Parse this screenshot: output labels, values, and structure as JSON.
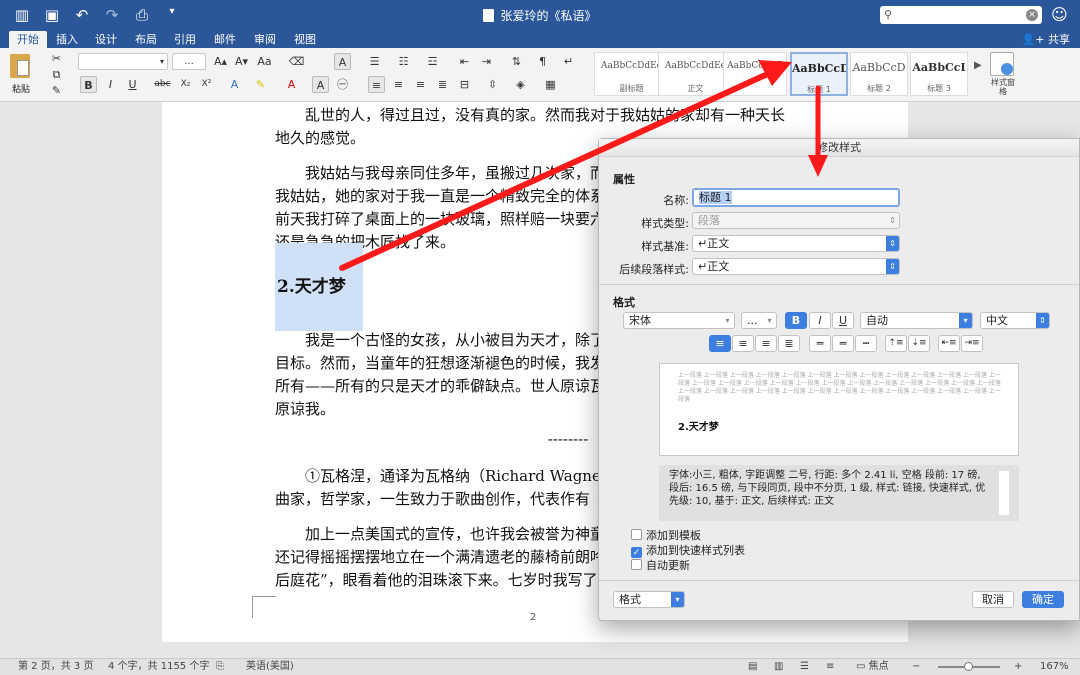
{
  "titlebar": {
    "doc_title": "张爱玲的《私语》",
    "search_placeholder": "",
    "icons": [
      "sidebar-icon",
      "save-icon",
      "undo-icon",
      "redo-icon",
      "print-icon",
      "customize-icon"
    ]
  },
  "tabs": [
    "开始",
    "插入",
    "设计",
    "布局",
    "引用",
    "邮件",
    "审阅",
    "视图"
  ],
  "share_label": "共享",
  "ribbon": {
    "paste_label": "粘贴",
    "font_name": "",
    "font_size": "...",
    "styles": [
      {
        "sample": "AaBbCcDdEe",
        "name": "副标题"
      },
      {
        "sample": "AaBbCcDdEe",
        "name": "正文"
      },
      {
        "sample": "AaBbCcDdE",
        "name": ""
      },
      {
        "sample": "AaBbCcD",
        "name": "标题 1"
      },
      {
        "sample": "AaBbCcD",
        "name": "标题 2"
      },
      {
        "sample": "AaBbCcI",
        "name": "标题 3"
      }
    ],
    "style_pane_label": "样式窗格"
  },
  "document": {
    "para1": "乱世的人，得过且过，没有真的家。然而我对于我姑姑的家却有一种天长地久的感觉。",
    "para2": "我姑姑与我母亲同住多年，虽搬过几次家，而我母亲不在的时候，单剩下我姑姑，她的家对于我一直是一个精致完全的体系，无论如何不能稍有毁损。前天我打碎了桌面上的一块玻璃，照样赔一块要六百元，而我天刚巧破产，但还是急急的把木匠找了来。",
    "heading": "2.天才梦",
    "para3": "我是一个古怪的女孩，从小被目为天才，除了发展我的天才外别无生存的目标。然而，当童年的狂想逐渐褪色的时候，我发现我除了天才的梦之外一无所有——所有的只是天才的乖僻缺点。世人原谅瓦格涅的疏狂，可是他们不会原谅我。",
    "separator": "--------",
    "para4": "①瓦格涅，通译为瓦格纳（Richard Wagner，1813—1883），德国作曲家，哲学家，一生致力于歌曲创作，代表作有《尼伯龙根的指环》。",
    "para5": "加上一点美国式的宣传，也许我会被誉为神童。我三岁时能背诵唐诗。我还记得摇摇摆摆地立在一个满清遗老的藤椅前朗吟“商女不知亡国恨，隔江犹唱后庭花”，眼看着他的泪珠滚下来。七岁时我写了第一部小说。",
    "page_number": "2"
  },
  "dialog": {
    "title": "修改样式",
    "properties_header": "属性",
    "name_label": "名称:",
    "name_value": "标题 1",
    "style_type_label": "样式类型:",
    "style_type_value": "段落",
    "based_on_label": "样式基准:",
    "based_on_value": "↵正文",
    "next_style_label": "后续段落样式:",
    "next_style_value": "↵正文",
    "format_header": "格式",
    "font": "宋体",
    "font_size": "...",
    "bold": "B",
    "italic": "I",
    "underline": "U",
    "color": "自动",
    "script": "中文",
    "preview_ghost": "上一段落 上一段落 上一段落 上一段落 上一段落 上一段落 上一段落 上一段落 上一段落 上一段落 上一段落 上一段落 上一段落 上一段落 上一段落 上一段落 上一段落 上一段落 上一段落 上一段落 上一段落 上一段落 上一段落 上一段落 上一段落 上一段落 上一段落 上一段落 上一段落 上一段落 上一段落 上一段落 上一段落 上一段落 上一段落 上一段落 上一段落 上一段落",
    "preview_text": "2.天才梦",
    "description": "字体:小三, 粗体, 字距调整 二号, 行距:  多个 2.41 li, 空格 段前: 17 磅, 段后: 16.5 磅, 与下段同页, 段中不分页, 1 级, 样式: 链接, 快速样式, 优先级: 10, 基于: 正文, 后续样式: 正文",
    "add_to_template": "添加到模板",
    "add_to_quick_styles": "添加到快速样式列表",
    "auto_update": "自动更新",
    "format_menu": "格式",
    "cancel": "取消",
    "ok": "确定"
  },
  "statusbar": {
    "page": "第 2 页，共 3 页",
    "words": "4 个字，共 1155 个字",
    "language": "英语(美国)",
    "focus": "焦点",
    "zoom": "167%"
  },
  "colors": {
    "accent": "#2b579a",
    "dialog_blue": "#3d7fe0",
    "annotation_arrow": "#ff1a1a"
  }
}
